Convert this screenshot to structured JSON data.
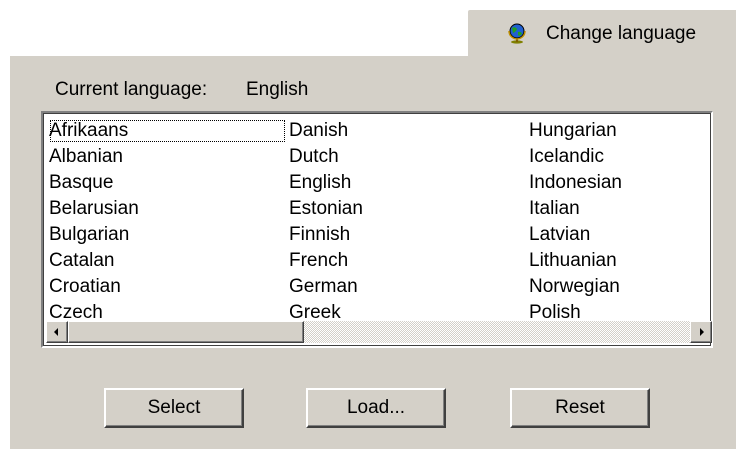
{
  "tab": {
    "label": "Change language",
    "icon": "globe-icon"
  },
  "current": {
    "label": "Current language:",
    "value": "English"
  },
  "languages": {
    "columns": [
      [
        "Afrikaans",
        "Albanian",
        "Basque",
        "Belarusian",
        "Bulgarian",
        "Catalan",
        "Croatian",
        "Czech"
      ],
      [
        "Danish",
        "Dutch",
        "English",
        "Estonian",
        "Finnish",
        "French",
        "German",
        "Greek"
      ],
      [
        "Hungarian",
        "Icelandic",
        "Indonesian",
        "Italian",
        "Latvian",
        "Lithuanian",
        "Norwegian",
        "Polish"
      ]
    ],
    "focused": "Afrikaans"
  },
  "buttons": {
    "select": "Select",
    "load": "Load...",
    "reset": "Reset"
  },
  "colors": {
    "face": "#d4d0c8",
    "highlight": "#ffffff",
    "shadow": "#808080",
    "dark_shadow": "#404040"
  }
}
